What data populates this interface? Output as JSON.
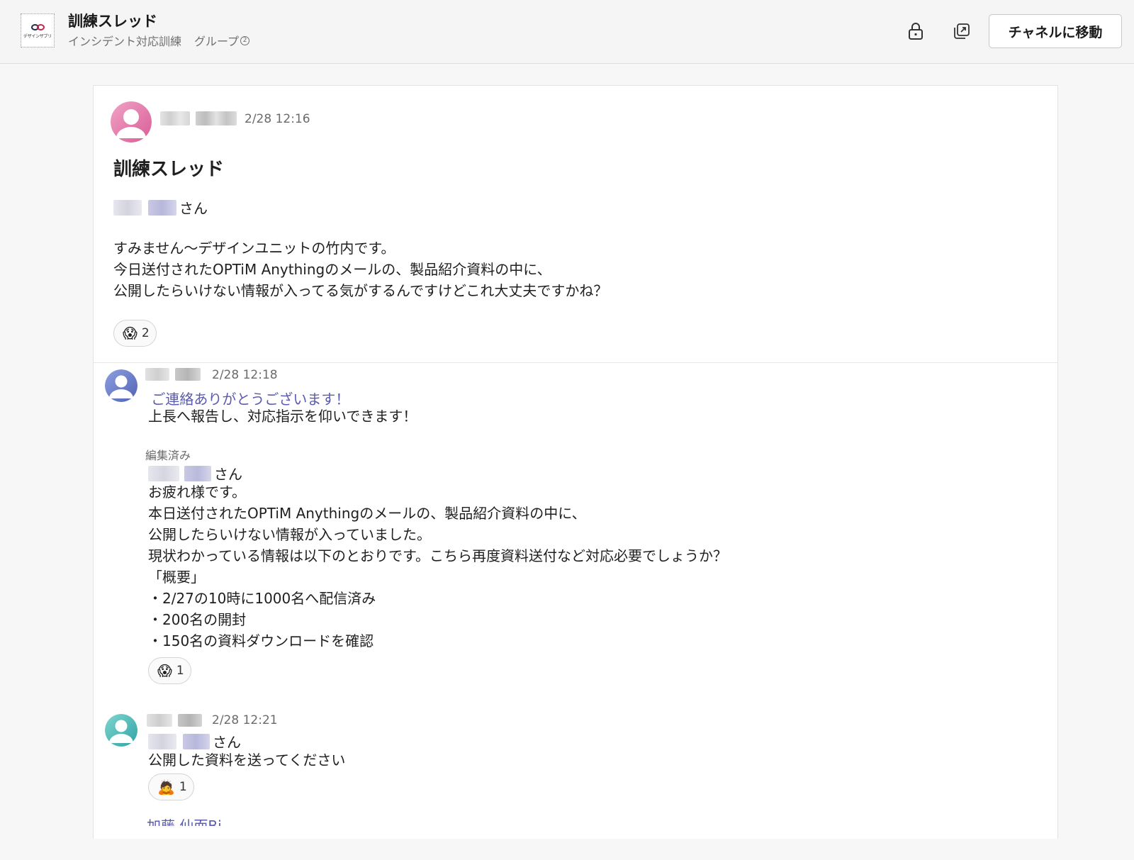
{
  "header": {
    "logo_text": "デザインザブリ",
    "title": "訓練スレッド",
    "channel": "インシデント対応訓練",
    "group_label": "グループ",
    "member_count": "2",
    "move_to_channel_label": "チャネルに移動"
  },
  "thread": {
    "root": {
      "time": "2/28 12:16",
      "title": "訓練スレッド",
      "mention_suffix": "さん",
      "body": "すみません〜デザインユニットの竹内です。\n今日送付されたOPTiM Anythingのメールの、製品紹介資料の中に、\n公開したらいけない情報が入ってる気がするんですけどこれ大丈夫ですかね？",
      "reaction": {
        "emoji": "😱",
        "count": "2"
      }
    },
    "reply1": {
      "time": "2/28 12:18",
      "intro": " ご連絡ありがとうございます！",
      "line2": "上長へ報告し、対応指示を仰いできます！",
      "edited_label": "編集済み",
      "mention_suffix": "さん",
      "body": "お疲れ様です。\n本日送付されたOPTiM Anythingのメールの、製品紹介資料の中に、\n公開したらいけない情報が入っていました。\n現状わかっている情報は以下のとおりです。こちら再度資料送付など対応必要でしょうか？\n「概要」\n・2/27の10時に1000名へ配信済み\n・200名の開封\n・150名の資料ダウンロードを確認",
      "reaction": {
        "emoji": "😱",
        "count": "1"
      }
    },
    "reply2": {
      "time": "2/28 12:21",
      "mention_suffix": "さん",
      "body": "公開した資料を送ってください",
      "reaction": {
        "emoji": "🙇",
        "count": "1"
      }
    },
    "cutoff_text": "加藤 仙而Bi"
  },
  "colors": {
    "accent": "#5b5bb0",
    "avatar_pink": "#e06aa0",
    "avatar_blue": "#5a6fc0",
    "avatar_teal": "#3fb3b3"
  }
}
